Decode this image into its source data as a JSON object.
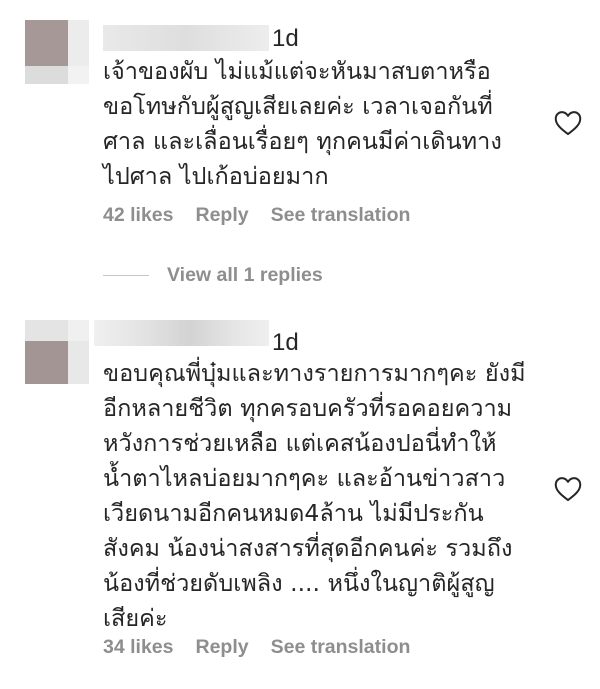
{
  "comments": [
    {
      "time": "1d",
      "text": "เจ้าของผับ ไม่แม้แต่จะหันมาสบตาหรือ\nขอโทษกับผู้สูญเสียเลยค่ะ เวลาเจอกันที่\nศาล และเลื่อนเรื่อยๆ ทุกคนมีค่าเดินทาง\nไปศาล ไปเก้อบ่อยมาก",
      "likes": "42 likes",
      "reply": "Reply",
      "translate": "See translation",
      "heart_icon": "heart-outline-icon"
    },
    {
      "time": "1d",
      "text": "ขอบคุณพี่บุ๋มและทางรายการมากๆคะ ยังมี\nอีกหลายชีวิต ทุกครอบครัวที่รอคอยความ\nหวังการช่วยเหลือ แต่เคสน้องปอนี่ทำให้\nน้ำตาไหลบ่อยมากๆคะ และอ้านข่าวสาว\nเวียดนามอีกคนหมด4ล้าน ไม่มีประกัน\nสังคม น้องน่าสงสารที่สุดอีกคนค่ะ รวมถึง\nน้องที่ช่วยดับเพลิง .... หนึ่งในญาติผู้สูญ\nเสียค่ะ",
      "likes": "34 likes",
      "reply": "Reply",
      "translate": "See translation",
      "heart_icon": "heart-outline-icon"
    }
  ],
  "view_replies": "View all 1 replies",
  "colors": {
    "text": "#262626",
    "secondary": "#8e8e8e",
    "blur_light": "#ececec",
    "blur_mid": "#d8d8d8",
    "avatar_dark": "#a39594"
  }
}
